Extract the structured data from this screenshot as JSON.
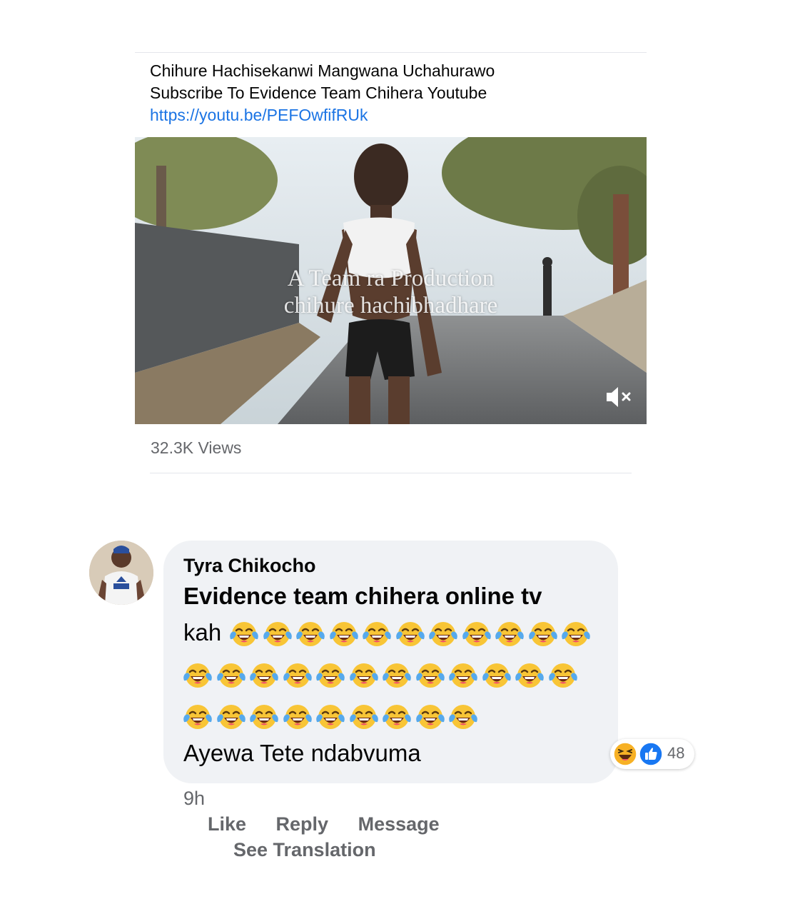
{
  "post": {
    "text_line_1": "Chihure Hachisekanwi Mangwana Uchahurawo",
    "text_line_2": "Subscribe To Evidence Team Chihera Youtube",
    "link": "https://youtu.be/PEFOwfifRUk",
    "video": {
      "caption_line_1": "A Team        ra   Production",
      "caption_line_2": "chihure hachibhadhare",
      "muted": true
    },
    "views": "32.3K Views"
  },
  "comment": {
    "author": "Tyra Chikocho",
    "line_bold": "Evidence team chihera online tv",
    "prefix": "kah",
    "emoji_icon": "face-with-tears-of-joy",
    "emoji_rows": [
      11,
      12,
      9
    ],
    "last_line": "Ayewa Tete ndabvuma",
    "reaction_count": "48",
    "reaction_icons": [
      "haha-icon",
      "like-icon"
    ],
    "time": "9h",
    "actions": {
      "like": "Like",
      "reply": "Reply",
      "message": "Message",
      "translate": "See Translation"
    }
  },
  "colors": {
    "link": "#1b74e4",
    "bubble": "#f0f2f5",
    "secondary_text": "#65676b",
    "like_blue": "#1877f2"
  }
}
